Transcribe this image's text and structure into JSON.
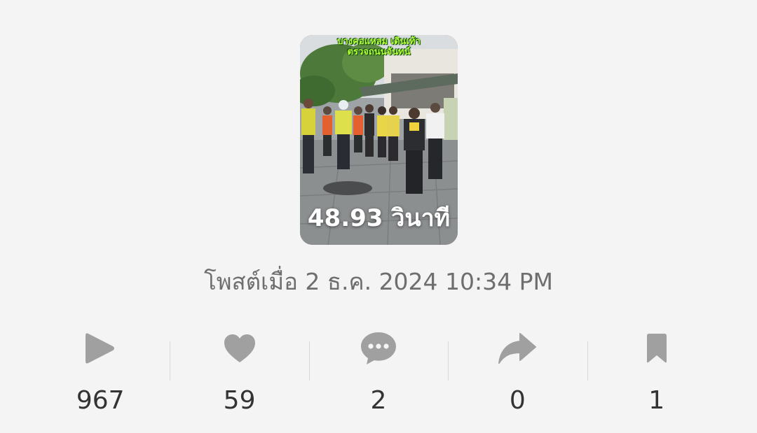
{
  "video": {
    "caption_line1": "บางคอแหลม เดินเท้า",
    "caption_line2": "ตรวจถนนจันทน์",
    "duration": "48.93 วินาที"
  },
  "posted": "โพสต์เมื่อ 2 ธ.ค. 2024 10:34 PM",
  "colors": {
    "background": "#f4f4f4",
    "icon": "#a0a0a0",
    "count": "#333333",
    "posted_text": "#6e6e6e"
  },
  "stats": [
    {
      "icon": "play-icon",
      "count": "967"
    },
    {
      "icon": "heart-icon",
      "count": "59"
    },
    {
      "icon": "comment-icon",
      "count": "2"
    },
    {
      "icon": "share-icon",
      "count": "0"
    },
    {
      "icon": "bookmark-icon",
      "count": "1"
    }
  ]
}
